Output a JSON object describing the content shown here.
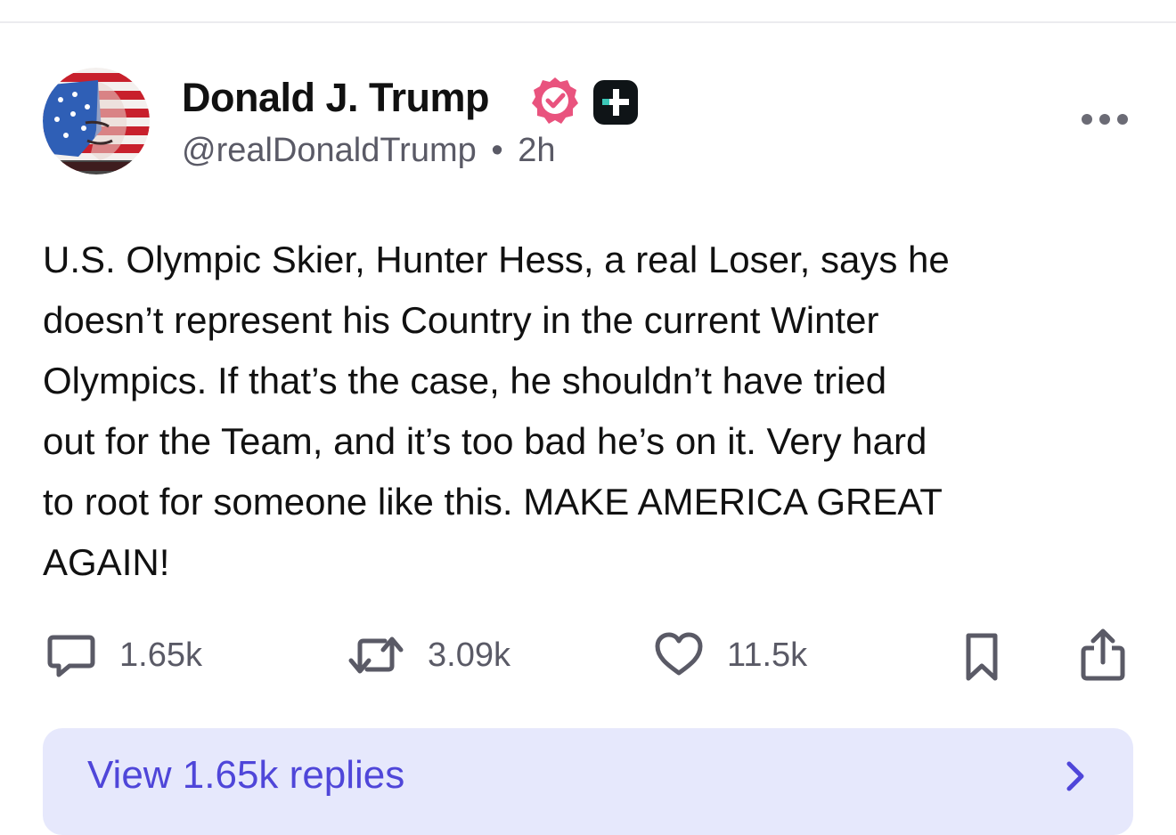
{
  "post": {
    "author": {
      "display_name": "Donald J. Trump",
      "handle": "@realDonaldTrump",
      "separator": "•",
      "time_ago": "2h",
      "verified": true
    },
    "body_lines": [
      "U.S. Olympic Skier, Hunter Hess, a real Loser, says he",
      "doesn’t represent his Country in the current Winter",
      "Olympics. If that’s the case, he shouldn’t have tried",
      "out for the Team, and it’s too bad he’s on it. Very hard",
      "to root for someone like this. MAKE AMERICA GREAT",
      "AGAIN!"
    ],
    "actions": {
      "replies_count": "1.65k",
      "reposts_count": "3.09k",
      "likes_count": "11.5k"
    },
    "view_replies_label": "View 1.65k replies"
  },
  "colors": {
    "accent": "#4f46d9",
    "verified_badge": "#e9537e",
    "view_replies_bg": "#e6e8fc",
    "muted_text": "#5a5a66",
    "icon_gray": "#5a5a66"
  },
  "icons": {
    "verified": "verified-badge-icon",
    "plus": "plus-badge-icon",
    "more": "more-horizontal-icon",
    "reply": "comment-icon",
    "repost": "repost-icon",
    "like": "heart-icon",
    "bookmark": "bookmark-icon",
    "share": "share-icon",
    "chevron": "chevron-right-icon"
  }
}
